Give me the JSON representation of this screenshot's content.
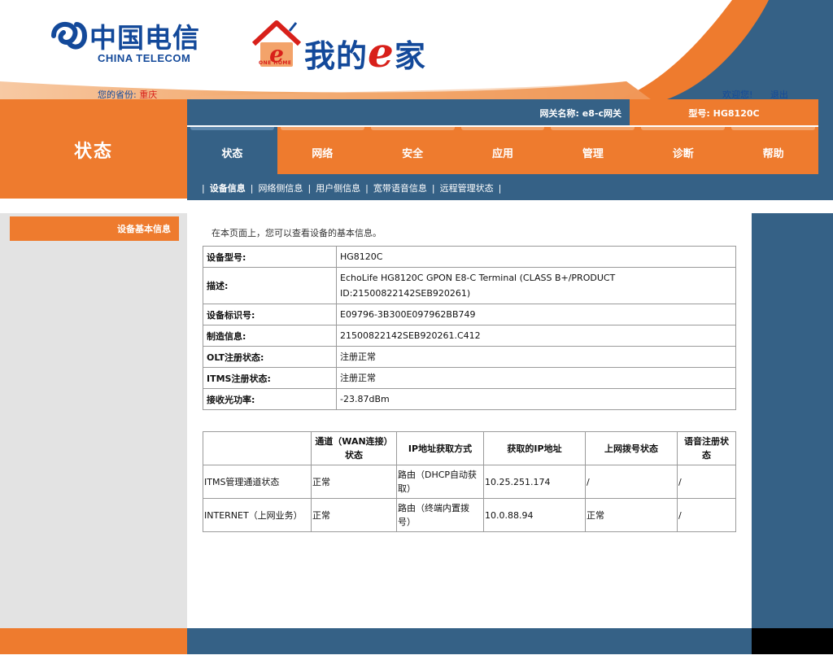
{
  "header": {
    "ct_logo_cn": "中国电信",
    "ct_logo_en": "CHINA TELECOM",
    "e8_logo_text": "我的",
    "e8_logo_e": "e",
    "e8_logo_suffix": "家",
    "e8_house_tag": "ONE HOME",
    "province_label": "您的省份:",
    "province_value": "重庆",
    "welcome": "欢迎您!",
    "logout": "退出"
  },
  "gateway": {
    "name_label": "网关名称:",
    "name_value": "e8-c网关",
    "model_label": "型号:",
    "model_value": "HG8120C"
  },
  "page_title": "状态",
  "tabs": [
    {
      "label": "状态",
      "active": true
    },
    {
      "label": "网络"
    },
    {
      "label": "安全"
    },
    {
      "label": "应用"
    },
    {
      "label": "管理"
    },
    {
      "label": "诊断"
    },
    {
      "label": "帮助"
    }
  ],
  "subnav": [
    {
      "label": "设备信息",
      "active": true
    },
    {
      "label": "网络侧信息"
    },
    {
      "label": "用户侧信息"
    },
    {
      "label": "宽带语音信息"
    },
    {
      "label": "远程管理状态"
    }
  ],
  "sidebar": {
    "items": [
      {
        "label": "设备基本信息"
      }
    ]
  },
  "main": {
    "intro": "在本页面上，您可以查看设备的基本信息。",
    "device_info": [
      {
        "key": "设备型号:",
        "value": "HG8120C"
      },
      {
        "key": "描述:",
        "value": "EchoLife HG8120C GPON E8-C Terminal (CLASS B+/PRODUCT ID:21500822142SEB920261)"
      },
      {
        "key": "设备标识号:",
        "value": "E09796-3B300E097962BB749"
      },
      {
        "key": "制造信息:",
        "value": "21500822142SEB920261.C412"
      },
      {
        "key": "OLT注册状态:",
        "value": "注册正常"
      },
      {
        "key": "ITMS注册状态:",
        "value": "注册正常"
      },
      {
        "key": "接收光功率:",
        "value": "-23.87dBm"
      }
    ],
    "wan_table": {
      "headers": [
        "",
        "通道（WAN连接）状态",
        "IP地址获取方式",
        "获取的IP地址",
        "上网拨号状态",
        "语音注册状态"
      ],
      "rows": [
        [
          "ITMS管理通道状态",
          "正常",
          "路由（DHCP自动获取）",
          "10.25.251.174",
          "/",
          "/"
        ],
        [
          "INTERNET（上网业务）",
          "正常",
          "路由（终端内置拨号）",
          "10.0.88.94",
          "正常",
          "/"
        ]
      ]
    }
  },
  "colors": {
    "orange": "#ee7b2e",
    "blue": "#356186",
    "logo_blue": "#13499a",
    "logo_red": "#d8201a"
  },
  "icons": {
    "ct_logo": "china-telecom-mark-icon",
    "e8_logo": "house-e-icon"
  }
}
